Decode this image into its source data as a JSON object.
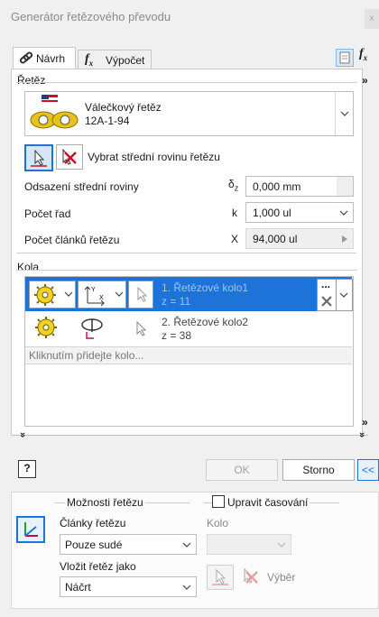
{
  "window": {
    "title": "Generátor řetězového převodu",
    "close_glyph": "x"
  },
  "tabs": [
    {
      "label": "Návrh",
      "icon": "chain-link-icon"
    },
    {
      "label": "Výpočet",
      "icon": "formula-icon"
    }
  ],
  "chain": {
    "section_label": "Řetěz",
    "type_name": "Válečkový řetěz",
    "type_code": "12A-1-94",
    "select_plane_label": "Vybrat střední rovinu řetězu",
    "offset_label": "Odsazení střední roviny",
    "offset_symbol": "δ",
    "offset_symbol_sub": "z",
    "offset_value": "0,000 mm",
    "rows_label": "Počet řad",
    "rows_symbol": "k",
    "rows_value": "1,000 ul",
    "links_label": "Počet článků řetězu",
    "links_symbol": "X",
    "links_value": "94,000 ul"
  },
  "wheels": {
    "section_label": "Kola",
    "items": [
      {
        "name": "1. Řetězové kolo1",
        "teeth": "z = 11",
        "selected": true
      },
      {
        "name": "2. Řetězové kolo2",
        "teeth": "z = 38",
        "selected": false
      }
    ],
    "add_hint": "Kliknutím přidejte kolo...",
    "more_glyph": "..."
  },
  "buttons": {
    "help": "?",
    "ok": "OK",
    "cancel": "Storno",
    "collapse": "<<"
  },
  "options": {
    "section_label": "Možnosti řetězu",
    "links_label": "Články řetězu",
    "links_value": "Pouze sudé",
    "insert_label": "Vložit řetěz jako",
    "insert_value": "Náčrt"
  },
  "timing": {
    "checkbox_label": "Upravit časování",
    "checked": false,
    "wheel_label": "Kolo",
    "wheel_value": "",
    "select_label": "Výběr"
  },
  "colors": {
    "accent": "#1e73d8",
    "selection": "#1e73d8"
  }
}
